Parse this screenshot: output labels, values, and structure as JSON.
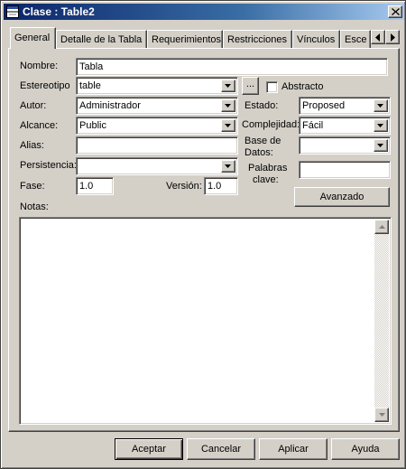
{
  "window": {
    "title": "Clase : Table2"
  },
  "tabs": [
    "General",
    "Detalle de la Tabla",
    "Requerimientos",
    "Restricciones",
    "Vínculos",
    "Esce"
  ],
  "form": {
    "nombre_label": "Nombre:",
    "nombre_value": "Tabla",
    "estereotipo_label": "Estereotipo",
    "estereotipo_value": "table",
    "ellipsis_label": "...",
    "abstracto_label": "Abstracto",
    "autor_label": "Autor:",
    "autor_value": "Administrador",
    "alcance_label": "Alcance:",
    "alcance_value": "Public",
    "alias_label": "Alias:",
    "alias_value": "",
    "persistencia_label": "Persistencia:",
    "persistencia_value": "",
    "fase_label": "Fase:",
    "fase_value": "1.0",
    "version_label": "Versión:",
    "version_value": "1.0",
    "estado_label": "Estado:",
    "estado_value": "Proposed",
    "complejidad_label": "Complejidad:",
    "complejidad_value": "Fácil",
    "base_datos_label_1": "Base de",
    "base_datos_label_2": "Datos:",
    "base_datos_value": "",
    "palabras_label_1": "Palabras",
    "palabras_label_2": "clave:",
    "palabras_value": "",
    "avanzado_label": "Avanzado",
    "notas_label": "Notas:"
  },
  "buttons": {
    "aceptar": "Aceptar",
    "cancelar": "Cancelar",
    "aplicar": "Aplicar",
    "ayuda": "Ayuda"
  },
  "icons": {
    "window": "class-window-icon",
    "close": "close-icon",
    "dropdown": "chevron-down-icon",
    "tab_left": "arrow-left-icon",
    "tab_right": "arrow-right-icon",
    "scroll_up": "arrow-up-icon",
    "scroll_down": "arrow-down-icon"
  }
}
